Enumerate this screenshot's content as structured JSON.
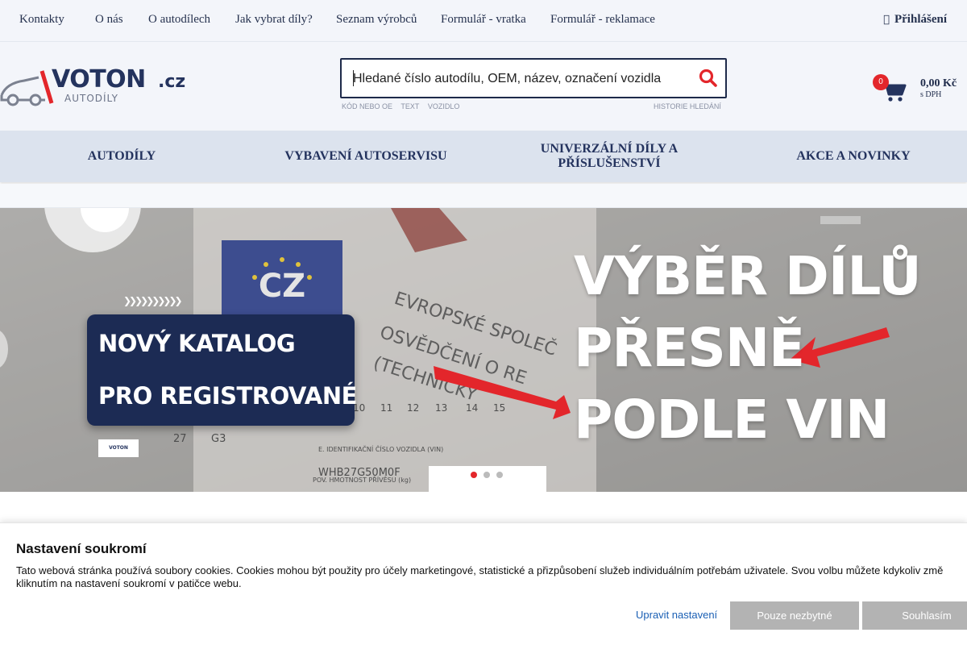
{
  "topbar": {
    "links": [
      "Kontakty",
      "O nás",
      "O autodílech",
      "Jak vybrat díly?",
      "Seznam výrobců",
      "Formulář - vratka",
      "Formulář - reklamace"
    ],
    "login": "Přihlášení",
    "login_icon": "user-icon"
  },
  "logo": {
    "word": "VOTON",
    "tld": ".cz",
    "sub": "AUTODÍLY"
  },
  "search": {
    "placeholder": "Hledané číslo autodílu, OEM, název, označení vozidla",
    "tags": [
      "KÓD NEBO OE",
      "TEXT",
      "VOZIDLO"
    ],
    "history": "HISTORIE HLEDÁNÍ",
    "icon": "search-icon"
  },
  "cart": {
    "count": "0",
    "price": "0,00 Kč",
    "vat": "s DPH",
    "icon": "cart-icon"
  },
  "mainnav": {
    "items": [
      "AUTODÍLY",
      "VYBAVENÍ AUTOSERVISU",
      "UNIVERZÁLNÍ DÍLY A PŘÍSLUŠENSTVÍ",
      "AKCE A NOVINKY"
    ]
  },
  "banner": {
    "card_line1": "NOVÝ KATALOG",
    "card_line2": "PRO REGISTROVANÉ",
    "headline": [
      "VÝBĚR DÍLŮ",
      "PŘESNĚ",
      "PODLE VIN"
    ],
    "active_slide": 1,
    "slide_count": 3
  },
  "cookie": {
    "title": "Nastavení soukromí",
    "text": "Tato webová stránka používá soubory cookies. Cookies mohou být použity pro účely marketingové, statistické a přizpůsobení služeb individuálním potřebám uživatele. Svou volbu můžete kdykoliv změ kliknutím na nastavení soukromí v patičce webu.",
    "settings_link": "Upravit nastavení",
    "necessary_button": "Pouze nezbytné",
    "accept_button": "Souhlasím"
  },
  "colors": {
    "brand_navy": "#24335e",
    "brand_red": "#e3262b",
    "nav_bg": "#dce3ee",
    "button_grey": "#b3b3b3"
  }
}
